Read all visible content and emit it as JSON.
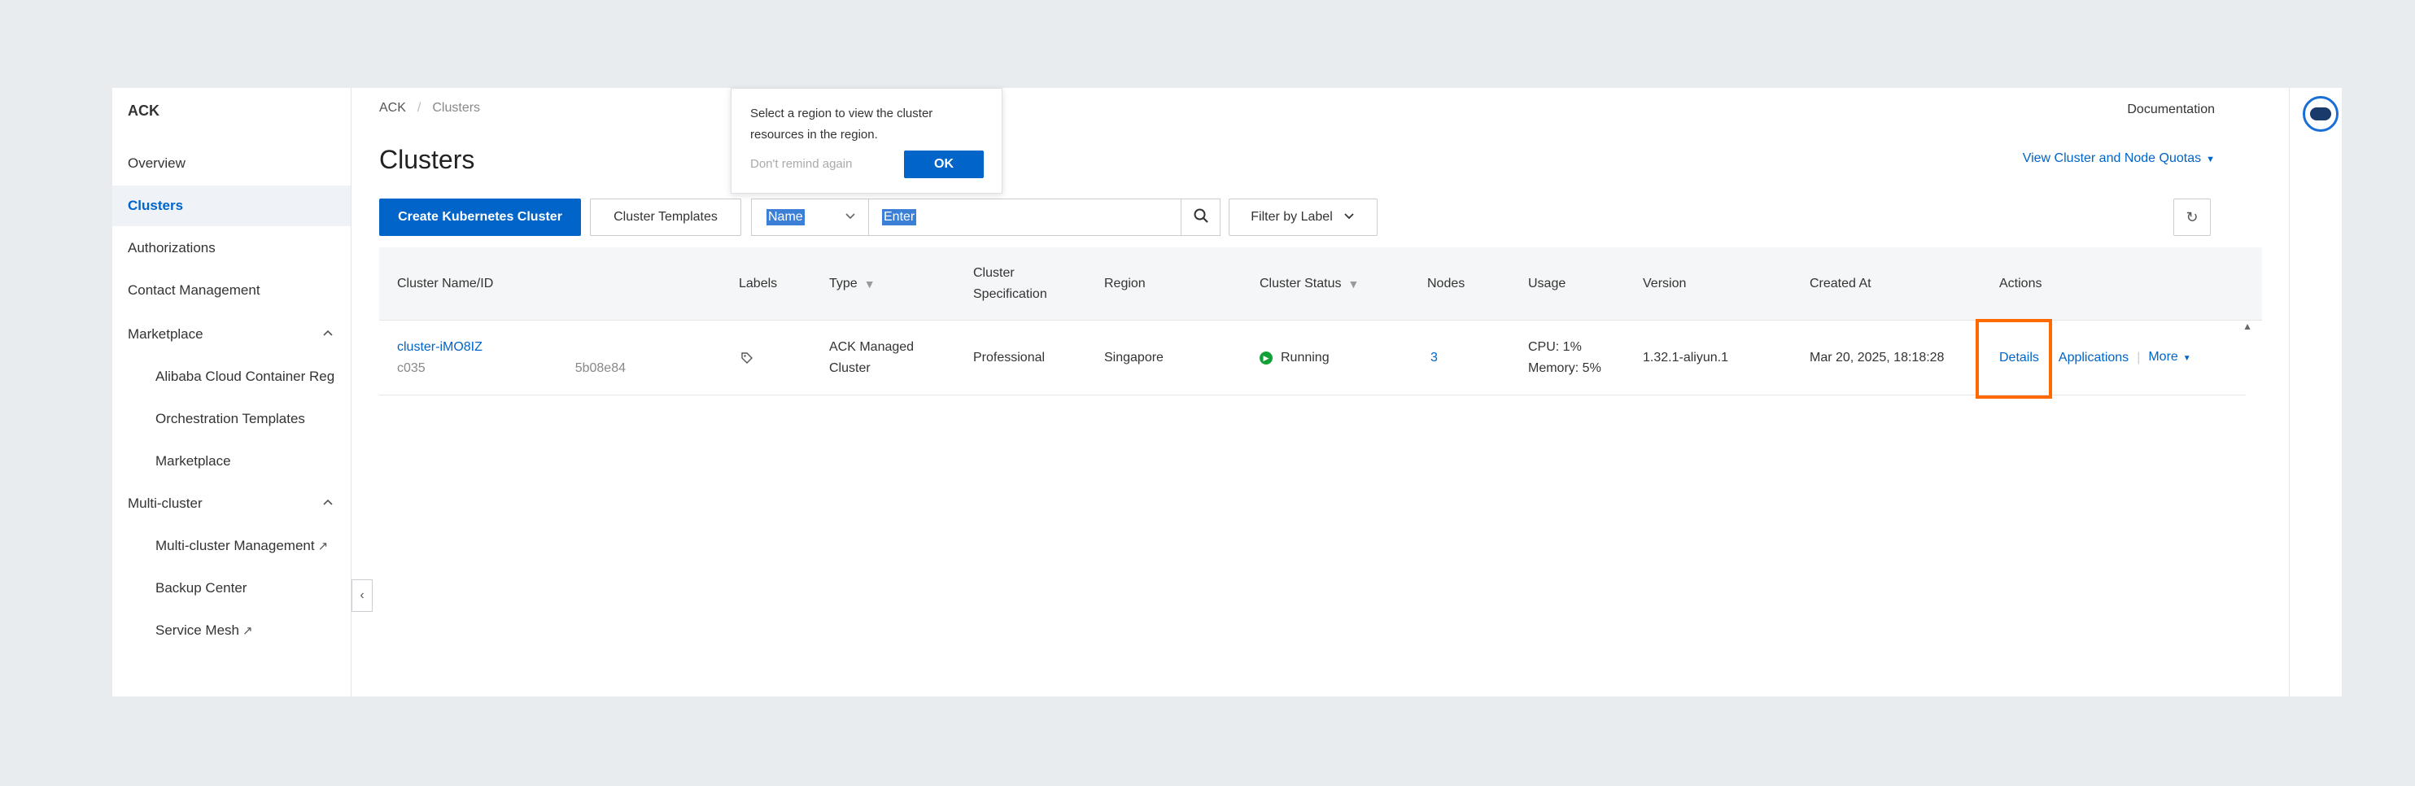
{
  "sidebar": {
    "title": "ACK",
    "items": [
      {
        "label": "Overview"
      },
      {
        "label": "Clusters"
      },
      {
        "label": "Authorizations"
      },
      {
        "label": "Contact Management"
      },
      {
        "label": "Marketplace"
      },
      {
        "label": "Alibaba Cloud Container Reg"
      },
      {
        "label": "Orchestration Templates"
      },
      {
        "label": "Marketplace"
      },
      {
        "label": "Multi-cluster"
      },
      {
        "label": "Multi-cluster Management"
      },
      {
        "label": "Backup Center"
      },
      {
        "label": "Service Mesh"
      }
    ]
  },
  "breadcrumb": {
    "root": "ACK",
    "sep": "/",
    "current": "Clusters"
  },
  "header": {
    "title": "Clusters",
    "documentation": "Documentation",
    "quota_link": "View Cluster and Node Quotas"
  },
  "toolbar": {
    "create": "Create Kubernetes Cluster",
    "templates": "Cluster Templates",
    "search_field": "Name",
    "search_placeholder": "Enter",
    "filter_label": "Filter by Label"
  },
  "popover": {
    "text": "Select a region to view the cluster resources in the region.",
    "dont_remind": "Don't remind again",
    "ok": "OK"
  },
  "table": {
    "headers": [
      "Cluster Name/ID",
      "Labels",
      "Type",
      "Cluster Specification",
      "Region",
      "Cluster Status",
      "Nodes",
      "Usage",
      "Version",
      "Created At",
      "Actions"
    ],
    "row": {
      "name": "cluster-iMO8IZ",
      "id_prefix": "c035",
      "id_suffix": "5b08e84",
      "type": "ACK Managed Cluster",
      "spec": "Professional",
      "region": "Singapore",
      "status": "Running",
      "nodes": "3",
      "cpu": "CPU: 1%",
      "memory": "Memory: 5%",
      "version": "1.32.1-aliyun.1",
      "created": "Mar 20, 2025, 18:18:28",
      "details": "Details",
      "applications": "Applications",
      "more": "More"
    }
  },
  "colors": {
    "accent": "#0064c8",
    "highlight": "#ff6a00",
    "running": "#12a136"
  }
}
